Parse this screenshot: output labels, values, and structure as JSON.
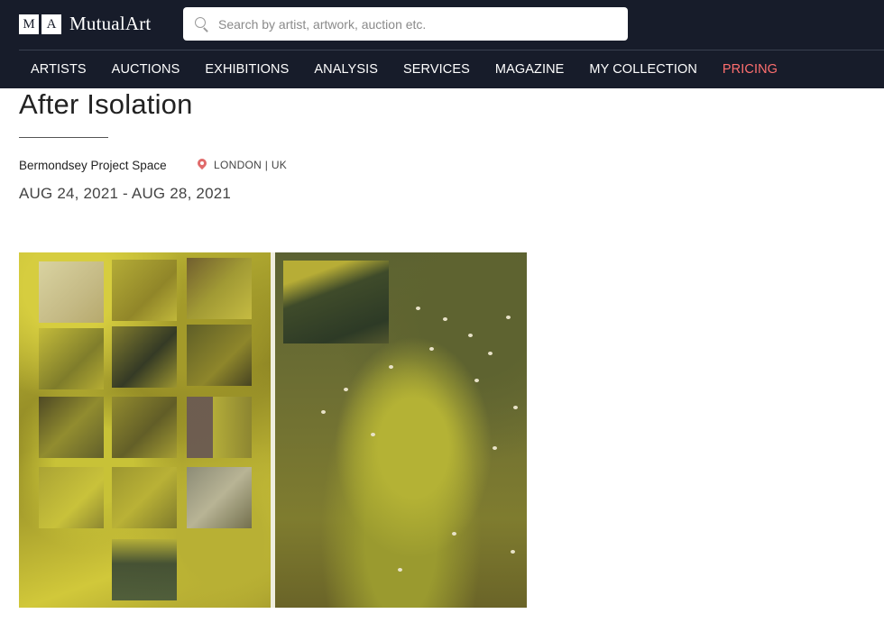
{
  "brand": {
    "mark_left": "M",
    "mark_right": "A",
    "name": "MutualArt"
  },
  "search": {
    "placeholder": "Search by artist, artwork, auction etc.",
    "value": ""
  },
  "nav": {
    "items": [
      {
        "label": "ARTISTS"
      },
      {
        "label": "AUCTIONS"
      },
      {
        "label": "EXHIBITIONS"
      },
      {
        "label": "ANALYSIS"
      },
      {
        "label": "SERVICES"
      },
      {
        "label": "MAGAZINE"
      },
      {
        "label": "MY COLLECTION"
      },
      {
        "label": "PRICING"
      }
    ],
    "highlight_color": "#ff6f6f"
  },
  "exhibition": {
    "title": "After Isolation",
    "venue": "Bermondsey Project Space",
    "location": "LONDON | UK",
    "dates": "AUG 24, 2021 - AUG 28, 2021"
  },
  "colors": {
    "header_bg": "#171c2a",
    "accent": "#e06a6a"
  },
  "icons": {
    "search": "search-icon",
    "location": "map-pin-icon"
  }
}
